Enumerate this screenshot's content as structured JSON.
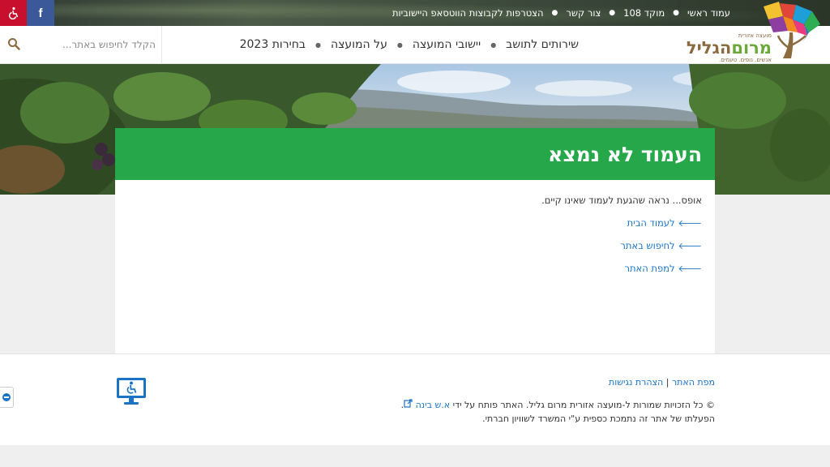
{
  "topbar": {
    "accessibility_icon": "wheelchair-icon",
    "facebook_icon": "facebook-icon",
    "facebook_label": "f",
    "links": [
      {
        "label": "עמוד ראשי"
      },
      {
        "label": "מוקד 108"
      },
      {
        "label": "צור קשר"
      },
      {
        "label": "הצטרפות לקבוצות הווטסאפ היישוביות"
      }
    ]
  },
  "header": {
    "search_placeholder": "הקלד לחיפוש באתר...",
    "search_icon": "search-icon",
    "nav": [
      {
        "label": "שירותים לתושב"
      },
      {
        "label": "יישובי המועצה"
      },
      {
        "label": "על המועצה"
      },
      {
        "label": "בחירות 2023"
      }
    ],
    "logo": {
      "small": "מועצה אזורית",
      "name_part1": "מרום",
      "name_part2": "הגליל",
      "tagline": "אנשים. נופים. טעמים."
    }
  },
  "content": {
    "title": "העמוד לא נמצא",
    "message": "אופס... נראה שהגעת לעמוד שאינו קיים.",
    "links": [
      {
        "label": "לעמוד הבית"
      },
      {
        "label": "לחיפוש באתר"
      },
      {
        "label": "למפת האתר"
      }
    ]
  },
  "footer": {
    "sitemap": "מפת האתר",
    "separator": "|",
    "accessibility_statement": "הצהרת נגישות",
    "copyright_prefix": "© כל הזכויות שמורות ל-מועצה אזורית מרום גליל. האתר פותח על ידי",
    "developer": "א.ש בינה",
    "funding": "הפעלתו של אתר זה נתמכת כספית ע\"י המשרד לשוויון חברתי."
  },
  "colors": {
    "accent_green": "#26a84a",
    "link_blue": "#1a73c4",
    "accessibility_red": "#c8102e",
    "facebook_blue": "#3b5998"
  }
}
